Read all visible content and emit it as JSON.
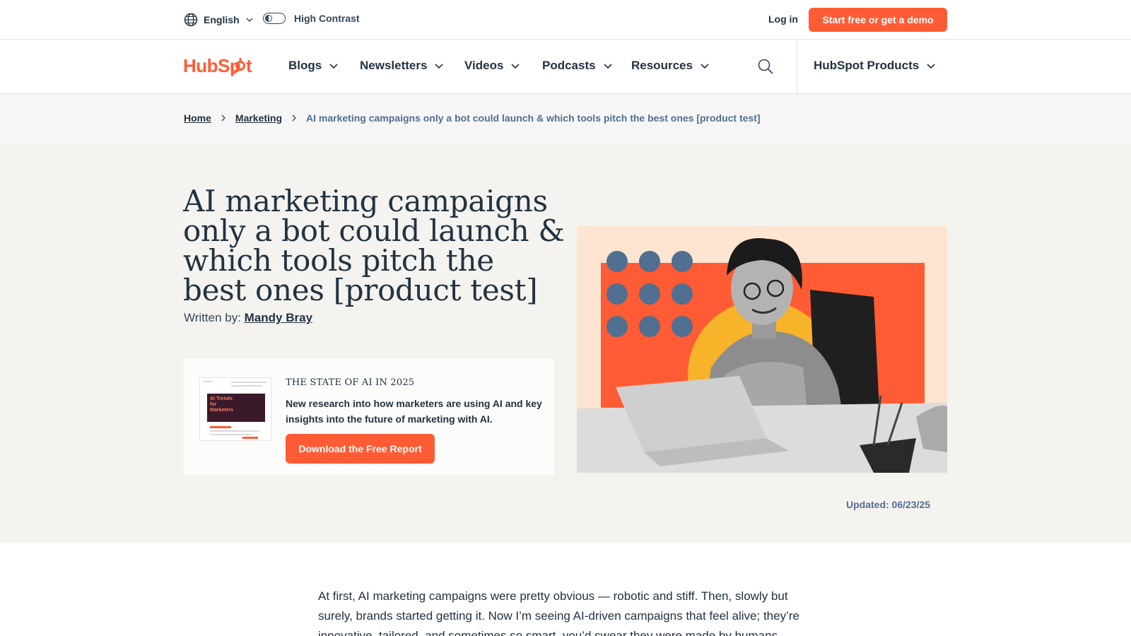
{
  "utility": {
    "language": "English",
    "high_contrast_label": "High Contrast",
    "login_label": "Log in",
    "cta_label": "Start free or get a demo"
  },
  "nav": {
    "logo_text": "HubSpot",
    "items": [
      "Blogs",
      "Newsletters",
      "Videos",
      "Podcasts",
      "Resources"
    ],
    "products_label": "HubSpot Products"
  },
  "breadcrumb": {
    "home": "Home",
    "section": "Marketing",
    "current": "AI marketing campaigns only a bot could launch & which tools pitch the best ones [product test]"
  },
  "article": {
    "title": "AI marketing campaigns only a bot could launch & which tools pitch the best ones [product test]",
    "byline_prefix": "Written by:",
    "author": "Mandy Bray",
    "updated": "Updated: 06/23/25",
    "intro": "At first, AI marketing campaigns were pretty obvious — robotic and stiff. Then, slowly but surely, brands started getting it. Now I’m seeing AI-driven campaigns that feel alive; they’re innovative, tailored, and sometimes so smart, you’d swear they were made by humans."
  },
  "promo": {
    "kicker": "THE STATE OF AI IN 2025",
    "description": "New research into how marketers are using AI and key insights into the future of marketing with AI.",
    "button_label": "Download the Free Report",
    "thumb_text": "AI Trends for Marketers"
  },
  "colors": {
    "brand_orange": "#ff5c35",
    "hero_bg": "#f5f3ef",
    "text_dark": "#213343"
  }
}
